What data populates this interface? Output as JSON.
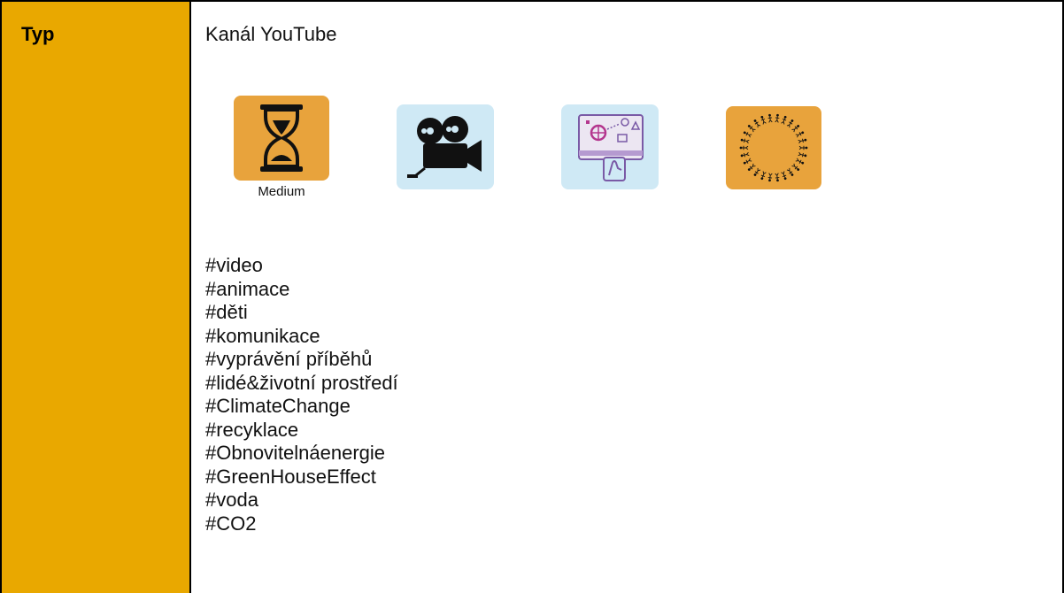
{
  "label": "Typ",
  "title": "Kanál YouTube",
  "icons": [
    {
      "name": "hourglass-icon",
      "bg": "#e8a33c",
      "caption": "Medium"
    },
    {
      "name": "film-camera-icon",
      "bg": "#cfe9f5"
    },
    {
      "name": "interactive-screen-icon",
      "bg": "#cfe9f5"
    },
    {
      "name": "people-circle-icon",
      "bg": "#e8a33c"
    }
  ],
  "tags": [
    "#video",
    "#animace",
    "#děti",
    "#komunikace",
    "#vyprávění příběhů",
    "#lidé&životní prostředí",
    "#ClimateChange",
    "#recyklace",
    "#Obnovitelnáenergie",
    "#GreenHouseEffect",
    "#voda",
    "#CO2"
  ]
}
